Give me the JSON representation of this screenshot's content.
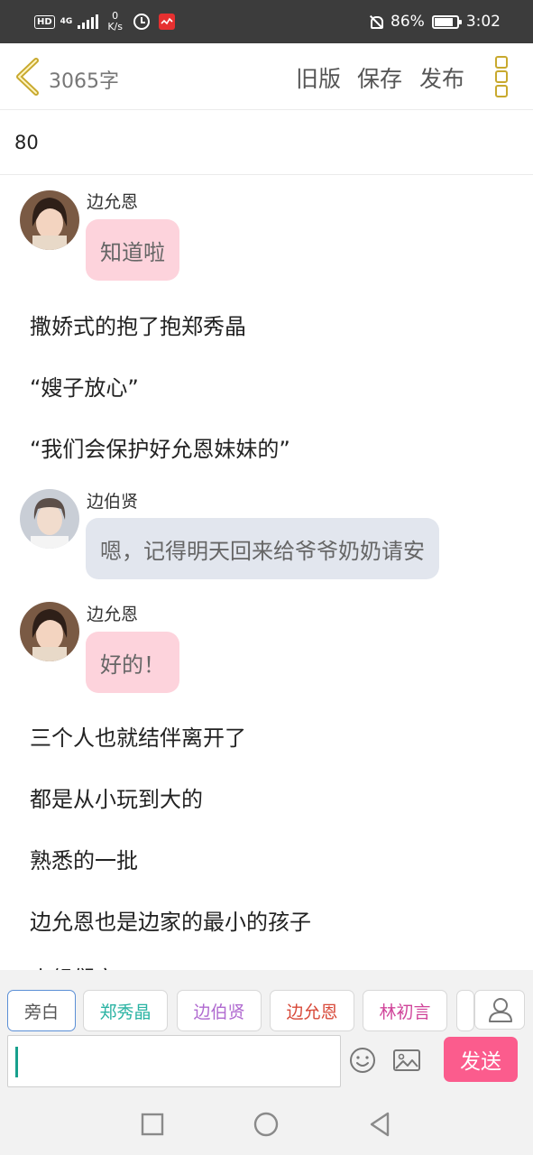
{
  "status_bar": {
    "hd": "HD",
    "network": "4G",
    "speed_value": "0",
    "speed_unit": "K/s",
    "battery": "86%",
    "time": "3:02"
  },
  "header": {
    "word_count": "3065字",
    "old_version": "旧版",
    "save": "保存",
    "publish": "发布",
    "accent_color": "#c8a92e"
  },
  "title": "80",
  "messages": [
    {
      "type": "dialogue",
      "speaker": "边允恩",
      "text": "知道啦",
      "bubble_color": "#fdd3dc"
    },
    {
      "type": "narration",
      "text": "撒娇式的抱了抱郑秀晶"
    },
    {
      "type": "narration",
      "text": "“嫂子放心”"
    },
    {
      "type": "narration",
      "text": "“我们会保护好允恩妹妹的”"
    },
    {
      "type": "dialogue",
      "speaker": "边伯贤",
      "text": "嗯，记得明天回来给爷爷奶奶请安",
      "bubble_color": "#e2e6ee"
    },
    {
      "type": "dialogue",
      "speaker": "边允恩",
      "text": "好的！",
      "bubble_color": "#fdd3dc"
    },
    {
      "type": "narration",
      "text": "三个人也就结伴离开了"
    },
    {
      "type": "narration",
      "text": "都是从小玩到大的"
    },
    {
      "type": "narration",
      "text": "熟悉的一批"
    },
    {
      "type": "narration",
      "text": "边允恩也是边家的最小的孩子"
    },
    {
      "type": "narration",
      "text": "小组们宠"
    }
  ],
  "roles": [
    {
      "label": "旁白",
      "color": "#666666",
      "selected": true
    },
    {
      "label": "郑秀晶",
      "color": "#2ab3a3",
      "selected": false
    },
    {
      "label": "边伯贤",
      "color": "#b06ad0",
      "selected": false
    },
    {
      "label": "边允恩",
      "color": "#d84a3a",
      "selected": false
    },
    {
      "label": "林初言",
      "color": "#d0449a",
      "selected": false
    }
  ],
  "input": {
    "value": "",
    "send_label": "发送",
    "send_color": "#fb5c8d"
  },
  "icons": {
    "back": "chevron-left-icon",
    "more": "more-vertical-icon",
    "emoji": "smile-icon",
    "image": "image-icon",
    "role_manage": "user-icon",
    "nav_recent": "square-icon",
    "nav_home": "circle-icon",
    "nav_back": "triangle-back-icon"
  }
}
